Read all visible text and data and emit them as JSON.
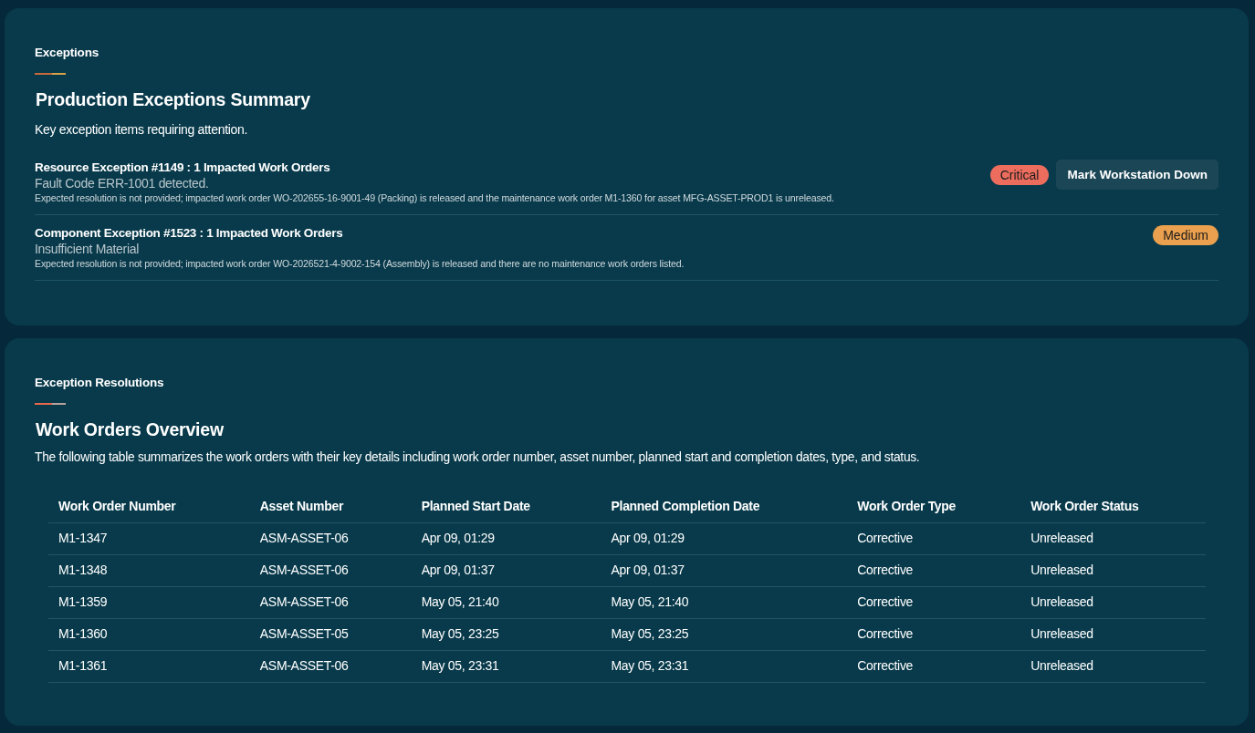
{
  "exceptions_panel": {
    "eyebrow": "Exceptions",
    "title": "Production Exceptions Summary",
    "subtitle": "Key exception items requiring attention.",
    "exceptions": [
      {
        "title": "Resource Exception #1149 : 1 Impacted Work Orders",
        "reason": "Fault Code ERR-1001 detected.",
        "details": "Expected resolution is not provided; impacted work order WO-202655-16-9001-49 (Packing) is released and the maintenance work order M1-1360 for asset MFG-ASSET-PROD1 is unreleased.",
        "severity": "Critical",
        "color": "#ec6d5e",
        "action": "Mark Workstation Down"
      },
      {
        "title": "Component Exception #1523 : 1 Impacted Work Orders",
        "reason": "Insufficient Material",
        "details": "Expected resolution is not provided; impacted work order WO-2026521-4-9002-154 (Assembly) is released and there are no maintenance work orders listed.",
        "severity": "Medium",
        "color": "#eaa04e"
      }
    ]
  },
  "resolutions_panel": {
    "eyebrow": "Exception Resolutions",
    "title": "Work Orders Overview",
    "description": "The following table summarizes the work orders with their key details including work order number, asset number, planned start and completion dates, type, and status.",
    "table": {
      "columns": [
        "Work Order Number",
        "Asset Number",
        "Planned Start Date",
        "Planned Completion Date",
        "Work Order Type",
        "Work Order Status"
      ],
      "rows": [
        [
          "M1-1347",
          "ASM-ASSET-06",
          "Apr 09, 01:29",
          "Apr 09, 01:29",
          "Corrective",
          "Unreleased"
        ],
        [
          "M1-1348",
          "ASM-ASSET-06",
          "Apr 09, 01:37",
          "Apr 09, 01:37",
          "Corrective",
          "Unreleased"
        ],
        [
          "M1-1359",
          "ASM-ASSET-06",
          "May 05, 21:40",
          "May 05, 21:40",
          "Corrective",
          "Unreleased"
        ],
        [
          "M1-1360",
          "ASM-ASSET-05",
          "May 05, 23:25",
          "May 05, 23:25",
          "Corrective",
          "Unreleased"
        ],
        [
          "M1-1361",
          "ASM-ASSET-06",
          "May 05, 23:31",
          "May 05, 23:31",
          "Corrective",
          "Unreleased"
        ]
      ]
    }
  }
}
